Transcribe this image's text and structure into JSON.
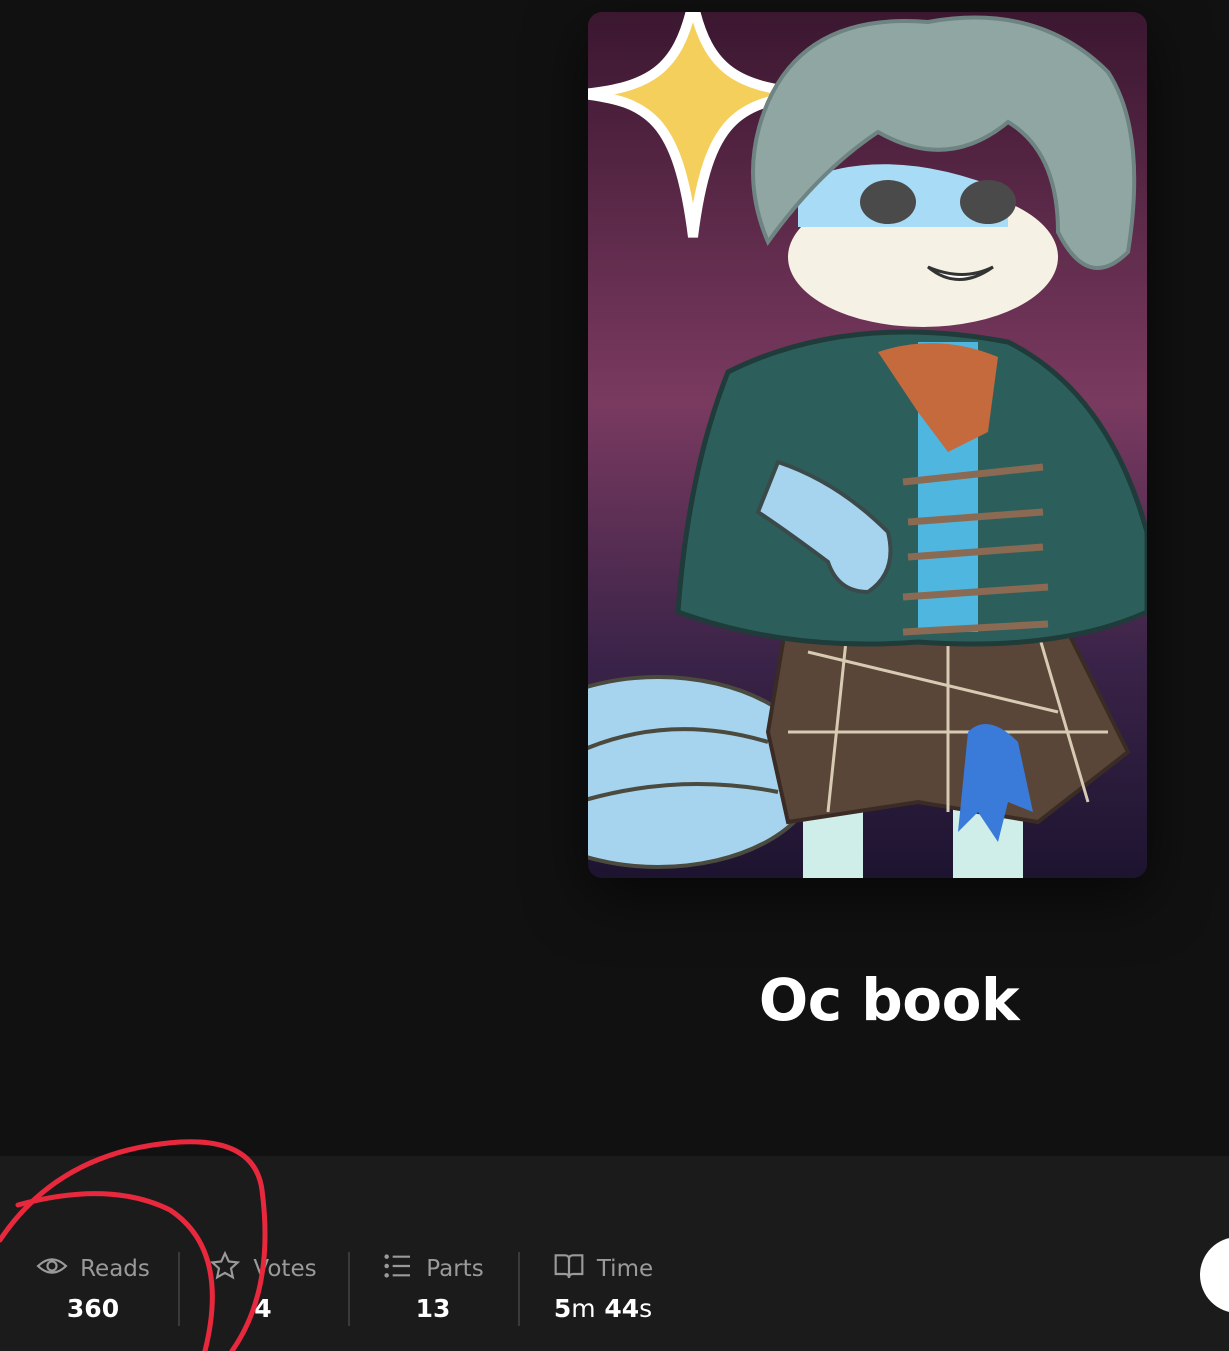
{
  "story": {
    "title": "Oc book"
  },
  "stats": [
    {
      "icon": "eye-icon",
      "label": "Reads",
      "value": "360"
    },
    {
      "icon": "star-icon",
      "label": "Votes",
      "value": "4"
    },
    {
      "icon": "list-icon",
      "label": "Parts",
      "value": "13"
    },
    {
      "icon": "book-icon",
      "label": "Time",
      "value_parts": {
        "minutes": "5",
        "m": "m",
        "seconds": "44",
        "s": "s"
      }
    }
  ],
  "colors": {
    "background": "#111111",
    "stats_bar": "#1b1b1b",
    "annotation": "#e8283c",
    "label_gray": "#9a9a9a"
  }
}
